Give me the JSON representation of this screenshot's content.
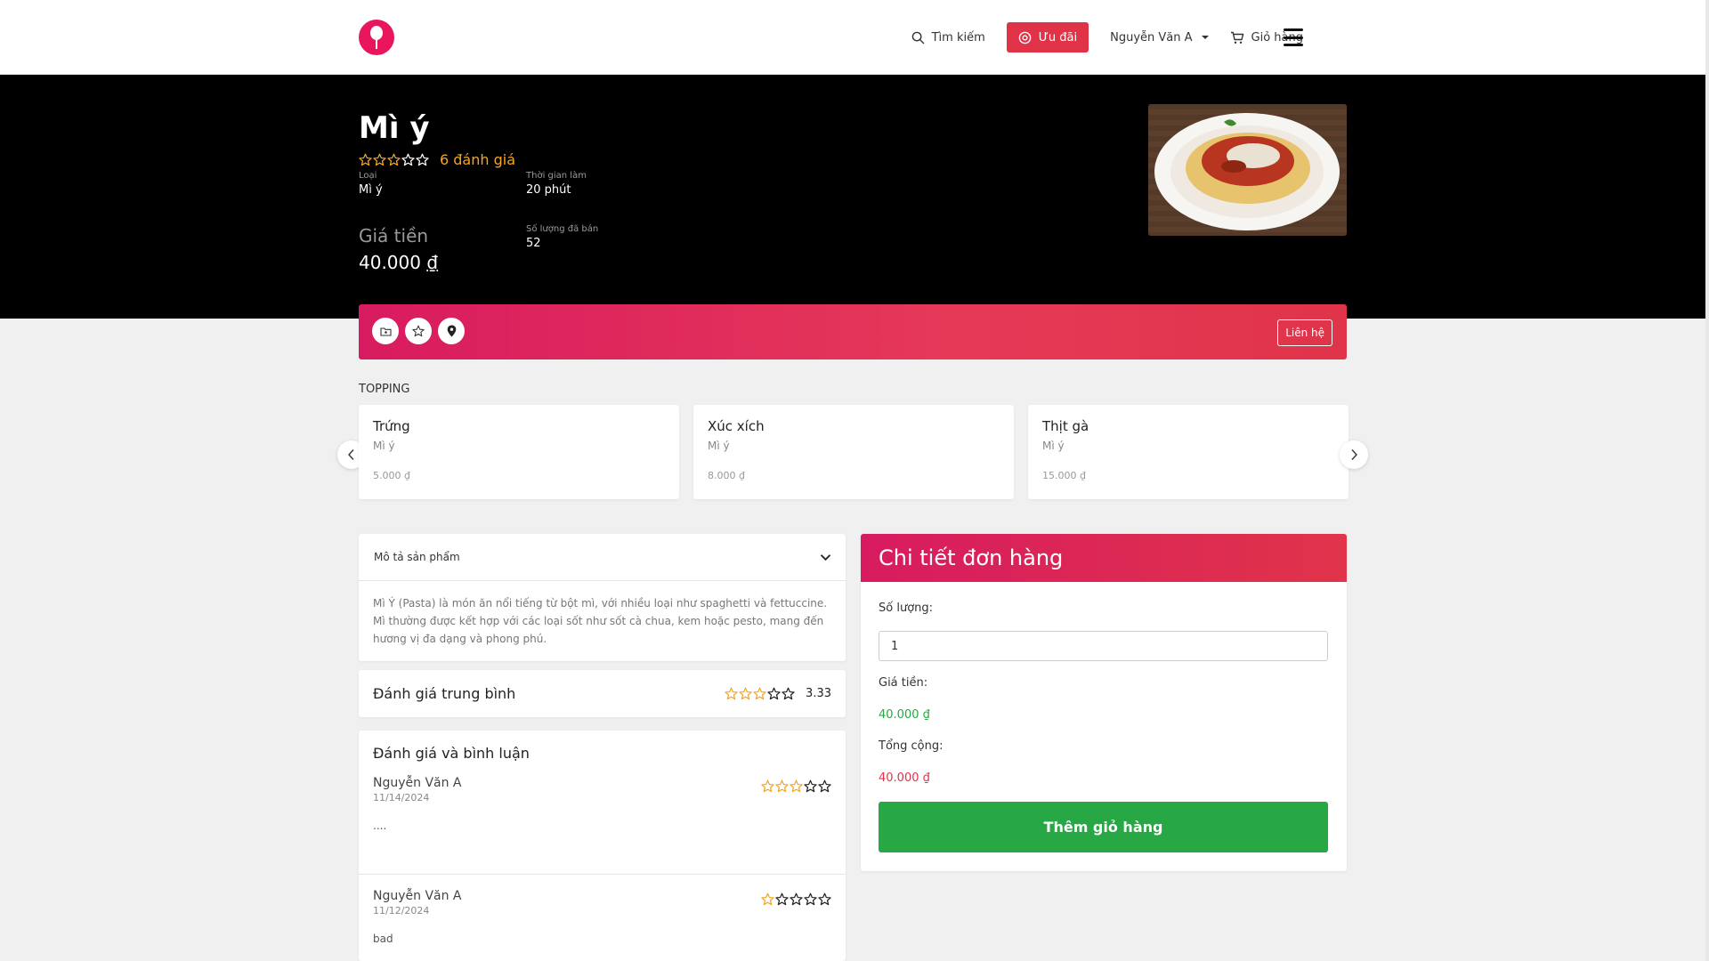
{
  "nav": {
    "search_label": "Tìm kiếm",
    "promo_label": "Ưu đãi",
    "user_name": "Nguyễn Văn A",
    "cart_label": "Giỏ hàng"
  },
  "product": {
    "name": "Mì ý",
    "rating_stars": 3,
    "review_count_label": "6 đánh giá",
    "category_label": "Loại",
    "category_value": "Mì ý",
    "time_label": "Thời gian làm",
    "time_value": "20 phút",
    "price_label": "Giá tiền",
    "price_number": "40.000",
    "price_currency": "₫",
    "sold_label": "Số lượng đã bán",
    "sold_value": "52"
  },
  "actions": {
    "contact_label": "Liên hệ"
  },
  "topping": {
    "title": "TOPPING",
    "items": [
      {
        "name": "Trứng",
        "category": "Mì ý",
        "price": "5.000 ₫"
      },
      {
        "name": "Xúc xích",
        "category": "Mì ý",
        "price": "8.000 ₫"
      },
      {
        "name": "Thịt gà",
        "category": "Mì ý",
        "price": "15.000 ₫"
      }
    ]
  },
  "description": {
    "header": "Mô tả sản phẩm",
    "body": "Mì Ý (Pasta) là món ăn nổi tiếng từ bột mì, với nhiều loại như spaghetti và fettuccine. Mì thường được kết hợp với các loại sốt như sốt cà chua, kem hoặc pesto, mang đến hương vị đa dạng và phong phú."
  },
  "average": {
    "label": "Đánh giá trung bình",
    "stars": 3,
    "value": "3.33"
  },
  "reviews": {
    "title": "Đánh giá và bình luận",
    "items": [
      {
        "name": "Nguyễn Văn A",
        "date": "11/14/2024",
        "stars": 3,
        "text": "...."
      },
      {
        "name": "Nguyễn Văn A",
        "date": "11/12/2024",
        "stars": 1,
        "text": "bad"
      }
    ]
  },
  "order": {
    "title": "Chi tiết đơn hàng",
    "quantity_label": "Số lượng:",
    "quantity_value": "1",
    "price_label": "Giá tiền:",
    "price_value": "40.000 ₫",
    "total_label": "Tổng cộng:",
    "total_value": "40.000 ₫",
    "add_to_cart_label": "Thêm giỏ hàng"
  },
  "colors": {
    "brand_pink": "#e8175d",
    "star_filled": "#f5a623",
    "price_green": "#28a745",
    "total_red": "#e03347"
  }
}
